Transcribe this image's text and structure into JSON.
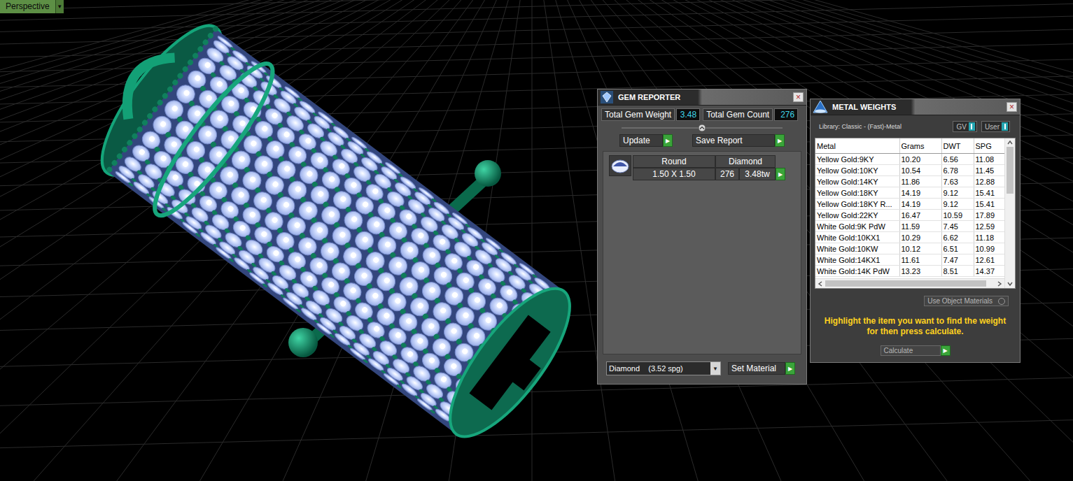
{
  "viewport": {
    "label": "Perspective",
    "menu": "▼"
  },
  "gem_reporter": {
    "title": "GEM REPORTER",
    "close": "×",
    "total_weight": {
      "label": "Total Gem Weight",
      "value": "3.48"
    },
    "total_count": {
      "label": "Total Gem Count",
      "value": "276"
    },
    "buttons": [
      {
        "label": "Update",
        "arrow": "▶"
      },
      {
        "label": "Save Report",
        "arrow": "▶"
      }
    ],
    "table": {
      "columns": [
        "Round",
        "Diamond"
      ],
      "rows": [
        {
          "size": "1.50 X 1.50",
          "count": "276",
          "weight": "3.48tw",
          "arrow": "▶"
        }
      ]
    },
    "material": {
      "value": "Diamond    (3.52 spg)",
      "arrow": "▼"
    },
    "set_material": {
      "label": "Set Material",
      "arrow": "▶"
    }
  },
  "metal_weights": {
    "title": "METAL WEIGHTS",
    "close": "×",
    "library": "Library: Classic - (Fast)-Metal",
    "toggles": [
      {
        "label": "GV",
        "on": true
      },
      {
        "label": "User",
        "on": true
      }
    ],
    "table": {
      "columns": [
        "Metal",
        "Grams",
        "DWT",
        "SPG"
      ],
      "rows": [
        [
          "Yellow Gold:9KY",
          "10.20",
          "6.56",
          "11.08"
        ],
        [
          "Yellow Gold:10KY",
          "10.54",
          "6.78",
          "11.45"
        ],
        [
          "Yellow Gold:14KY",
          "11.86",
          "7.63",
          "12.88"
        ],
        [
          "Yellow Gold:18KY",
          "14.19",
          "9.12",
          "15.41"
        ],
        [
          "Yellow Gold:18KY R...",
          "14.19",
          "9.12",
          "15.41"
        ],
        [
          "Yellow Gold:22KY",
          "16.47",
          "10.59",
          "17.89"
        ],
        [
          "White Gold:9K PdW",
          "11.59",
          "7.45",
          "12.59"
        ],
        [
          "White Gold:10KX1",
          "10.29",
          "6.62",
          "11.18"
        ],
        [
          "White Gold:10KW",
          "10.12",
          "6.51",
          "10.99"
        ],
        [
          "White Gold:14KX1",
          "11.61",
          "7.47",
          "12.61"
        ],
        [
          "White Gold:14K PdW",
          "13.23",
          "8.51",
          "14.37"
        ]
      ]
    },
    "scrollbar": {
      "level": 0.35
    },
    "use_object_materials": {
      "label": "Use Object Materials",
      "checked": false
    },
    "hint": "Highlight the item you want to find the weight for then press calculate.",
    "calculate": {
      "label": "Calculate",
      "arrow": "▶"
    }
  }
}
